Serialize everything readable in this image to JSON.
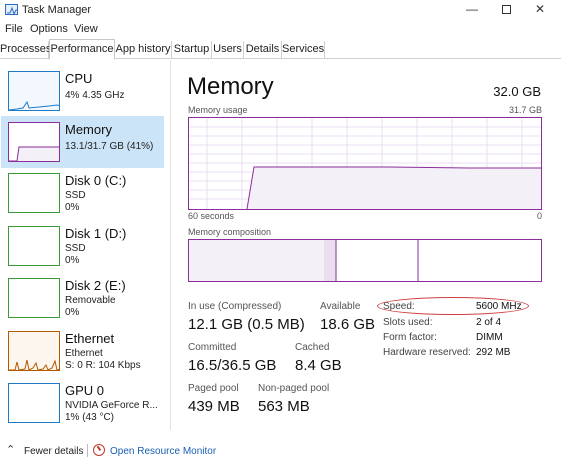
{
  "window": {
    "title": "Task Manager",
    "minimize": "—",
    "close": "✕"
  },
  "menu": [
    "File",
    "Options",
    "View"
  ],
  "tabs": [
    "Processes",
    "Performance",
    "App history",
    "Startup",
    "Users",
    "Details",
    "Services"
  ],
  "active_tab": "Performance",
  "sidebar": [
    {
      "name": "CPU",
      "sub1": "4% 4.35 GHz",
      "selected": false,
      "color": "#1e7ac5",
      "icon": "cpu-graph-icon"
    },
    {
      "name": "Memory",
      "sub1": "13.1/31.7 GB (41%)",
      "selected": true,
      "color": "#8b2d9b",
      "icon": "memory-graph-icon"
    },
    {
      "name": "Disk 0 (C:)",
      "sub1": "SSD",
      "sub2": "0%",
      "selected": false,
      "color": "#3a9b3a",
      "icon": "disk-graph-icon"
    },
    {
      "name": "Disk 1 (D:)",
      "sub1": "SSD",
      "sub2": "0%",
      "selected": false,
      "color": "#3a9b3a",
      "icon": "disk-graph-icon"
    },
    {
      "name": "Disk 2 (E:)",
      "sub1": "Removable",
      "sub2": "0%",
      "selected": false,
      "color": "#3a9b3a",
      "icon": "disk-graph-icon"
    },
    {
      "name": "Ethernet",
      "sub1": "Ethernet",
      "sub2": "S: 0 R: 104 Kbps",
      "selected": false,
      "color": "#b35a00",
      "icon": "ethernet-graph-icon"
    },
    {
      "name": "GPU 0",
      "sub1": "NVIDIA GeForce R...",
      "sub2": "1% (43 °C)",
      "selected": false,
      "color": "#1e7ac5",
      "icon": "gpu-graph-icon"
    }
  ],
  "memory": {
    "title": "Memory",
    "total": "32.0 GB",
    "usage_label": "Memory usage",
    "usage_max": "31.7 GB",
    "time_left": "60 seconds",
    "time_right": "0",
    "composition_label": "Memory composition",
    "stats": {
      "in_use_label": "In use (Compressed)",
      "in_use_value": "12.1 GB (0.5 MB)",
      "available_label": "Available",
      "available_value": "18.6 GB",
      "committed_label": "Committed",
      "committed_value": "16.5/36.5 GB",
      "cached_label": "Cached",
      "cached_value": "8.4 GB",
      "paged_label": "Paged pool",
      "paged_value": "439 MB",
      "nonpaged_label": "Non-paged pool",
      "nonpaged_value": "563 MB"
    },
    "details": [
      {
        "label": "Speed:",
        "value": "5600 MHz"
      },
      {
        "label": "Slots used:",
        "value": "2 of 4"
      },
      {
        "label": "Form factor:",
        "value": "DIMM"
      },
      {
        "label": "Hardware reserved:",
        "value": "292 MB"
      }
    ]
  },
  "footer": {
    "fewer_details": "Fewer details",
    "resource_monitor": "Open Resource Monitor"
  },
  "colors": {
    "memory_accent": "#8b2d9b",
    "memory_fill": "#f4f0f7",
    "highlight_oval": "#d04040",
    "selected_bg": "#cce4f7"
  }
}
